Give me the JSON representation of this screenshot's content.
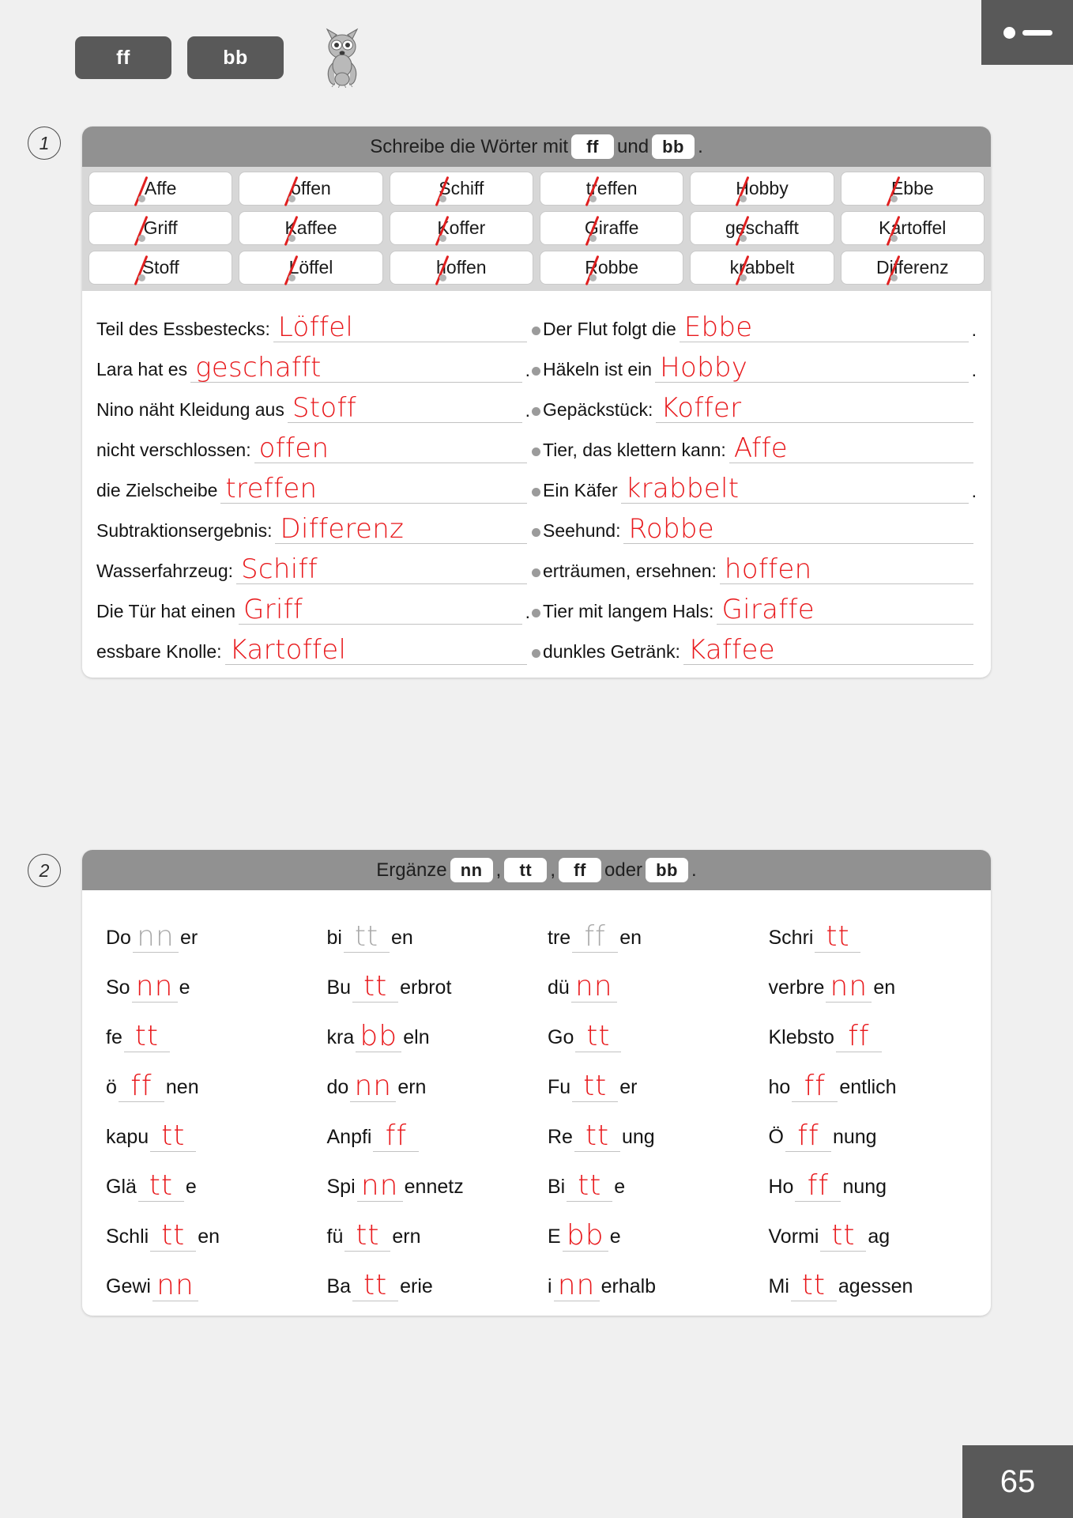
{
  "header": {
    "tag1": "ff",
    "tag2": "bb",
    "mascot": "raccoon-mascot",
    "toggle": "menu-toggle"
  },
  "exercise1": {
    "number": "1",
    "instruction_pre": "Schreibe die Wörter mit",
    "instruction_chip1": "ff",
    "instruction_mid": "und",
    "instruction_chip2": "bb",
    "instruction_end": ".",
    "wordbank": [
      [
        "Affe",
        "offen",
        "Schiff",
        "treffen",
        "Hobby",
        "Ebbe"
      ],
      [
        "Griff",
        "Kaffee",
        "Koffer",
        "Giraffe",
        "geschafft",
        "Kartoffel"
      ],
      [
        "Stoff",
        "Löffel",
        "hoffen",
        "Robbe",
        "krabbelt",
        "Differenz"
      ]
    ],
    "sentences": [
      {
        "left_pre": "Teil des Essbestecks:",
        "left_ans": "Löffel",
        "left_end": "",
        "right_pre": "Der Flut folgt die",
        "right_ans": "Ebbe",
        "right_end": "."
      },
      {
        "left_pre": "Lara hat es",
        "left_ans": "geschafft",
        "left_end": ".",
        "right_pre": "Häkeln ist ein",
        "right_ans": "Hobby",
        "right_end": "."
      },
      {
        "left_pre": "Nino näht Kleidung aus",
        "left_ans": "Stoff",
        "left_end": ".",
        "right_pre": "Gepäckstück:",
        "right_ans": "Koffer",
        "right_end": ""
      },
      {
        "left_pre": "nicht verschlossen:",
        "left_ans": "offen",
        "left_end": "",
        "right_pre": "Tier, das klettern kann:",
        "right_ans": "Affe",
        "right_end": ""
      },
      {
        "left_pre": "die Zielscheibe",
        "left_ans": "treffen",
        "left_end": "",
        "right_pre": "Ein Käfer",
        "right_ans": "krabbelt",
        "right_end": "."
      },
      {
        "left_pre": "Subtraktionsergebnis:",
        "left_ans": "Differenz",
        "left_end": "",
        "right_pre": "Seehund:",
        "right_ans": "Robbe",
        "right_end": ""
      },
      {
        "left_pre": "Wasserfahrzeug:",
        "left_ans": "Schiff",
        "left_end": "",
        "right_pre": "erträumen, ersehnen:",
        "right_ans": "hoffen",
        "right_end": ""
      },
      {
        "left_pre": "Die Tür hat einen",
        "left_ans": "Griff",
        "left_end": ".",
        "right_pre": "Tier mit langem Hals:",
        "right_ans": "Giraffe",
        "right_end": ""
      },
      {
        "left_pre": "essbare Knolle:",
        "left_ans": "Kartoffel",
        "left_end": "",
        "right_pre": "dunkles Getränk:",
        "right_ans": "Kaffee",
        "right_end": ""
      }
    ]
  },
  "exercise2": {
    "number": "2",
    "instruction_pre": "Ergänze",
    "chip1": "nn",
    "sep1": ",",
    "chip2": "tt",
    "sep2": ",",
    "chip3": "ff",
    "mid": "oder",
    "chip4": "bb",
    "instruction_end": ".",
    "rows": [
      [
        {
          "pre": "Do",
          "fill": "nn",
          "post": "er",
          "style": "gray"
        },
        {
          "pre": "bi",
          "fill": "tt",
          "post": "en",
          "style": "gray"
        },
        {
          "pre": "tre",
          "fill": "ff",
          "post": "en",
          "style": "gray"
        },
        {
          "pre": "Schri",
          "fill": "tt",
          "post": "",
          "style": "red"
        }
      ],
      [
        {
          "pre": "So",
          "fill": "nn",
          "post": "e",
          "style": "red"
        },
        {
          "pre": "Bu",
          "fill": "tt",
          "post": "erbrot",
          "style": "red"
        },
        {
          "pre": "dü",
          "fill": "nn",
          "post": "",
          "style": "red"
        },
        {
          "pre": "verbre",
          "fill": "nn",
          "post": "en",
          "style": "red"
        }
      ],
      [
        {
          "pre": "fe",
          "fill": "tt",
          "post": "",
          "style": "red"
        },
        {
          "pre": "kra",
          "fill": "bb",
          "post": "eln",
          "style": "red"
        },
        {
          "pre": "Go",
          "fill": "tt",
          "post": "",
          "style": "red"
        },
        {
          "pre": "Klebsto",
          "fill": "ff",
          "post": "",
          "style": "red"
        }
      ],
      [
        {
          "pre": "ö",
          "fill": "ff",
          "post": "nen",
          "style": "red"
        },
        {
          "pre": "do",
          "fill": "nn",
          "post": "ern",
          "style": "red"
        },
        {
          "pre": "Fu",
          "fill": "tt",
          "post": "er",
          "style": "red"
        },
        {
          "pre": "ho",
          "fill": "ff",
          "post": "entlich",
          "style": "red"
        }
      ],
      [
        {
          "pre": "kapu",
          "fill": "tt",
          "post": "",
          "style": "red"
        },
        {
          "pre": "Anpfi",
          "fill": "ff",
          "post": "",
          "style": "red"
        },
        {
          "pre": "Re",
          "fill": "tt",
          "post": "ung",
          "style": "red"
        },
        {
          "pre": "Ö",
          "fill": "ff",
          "post": "nung",
          "style": "red"
        }
      ],
      [
        {
          "pre": "Glä",
          "fill": "tt",
          "post": "e",
          "style": "red"
        },
        {
          "pre": "Spi",
          "fill": "nn",
          "post": "ennetz",
          "style": "red"
        },
        {
          "pre": "Bi",
          "fill": "tt",
          "post": "e",
          "style": "red"
        },
        {
          "pre": "Ho",
          "fill": "ff",
          "post": "nung",
          "style": "red"
        }
      ],
      [
        {
          "pre": "Schli",
          "fill": "tt",
          "post": "en",
          "style": "red"
        },
        {
          "pre": "fü",
          "fill": "tt",
          "post": "ern",
          "style": "red"
        },
        {
          "pre": "E",
          "fill": "bb",
          "post": "e",
          "style": "red"
        },
        {
          "pre": "Vormi",
          "fill": "tt",
          "post": "ag",
          "style": "red"
        }
      ],
      [
        {
          "pre": "Gewi",
          "fill": "nn",
          "post": "",
          "style": "red"
        },
        {
          "pre": "Ba",
          "fill": "tt",
          "post": "erie",
          "style": "red"
        },
        {
          "pre": "i",
          "fill": "nn",
          "post": "erhalb",
          "style": "red"
        },
        {
          "pre": "Mi",
          "fill": "tt",
          "post": "agessen",
          "style": "red"
        }
      ]
    ]
  },
  "footer": {
    "page_number": "65"
  },
  "colors": {
    "answer_red": "#e8191c",
    "prefill_gray": "#a9a9a9",
    "panel_header": "#919191",
    "dark_ui": "#595959",
    "page_bg": "#f0f0f0"
  }
}
